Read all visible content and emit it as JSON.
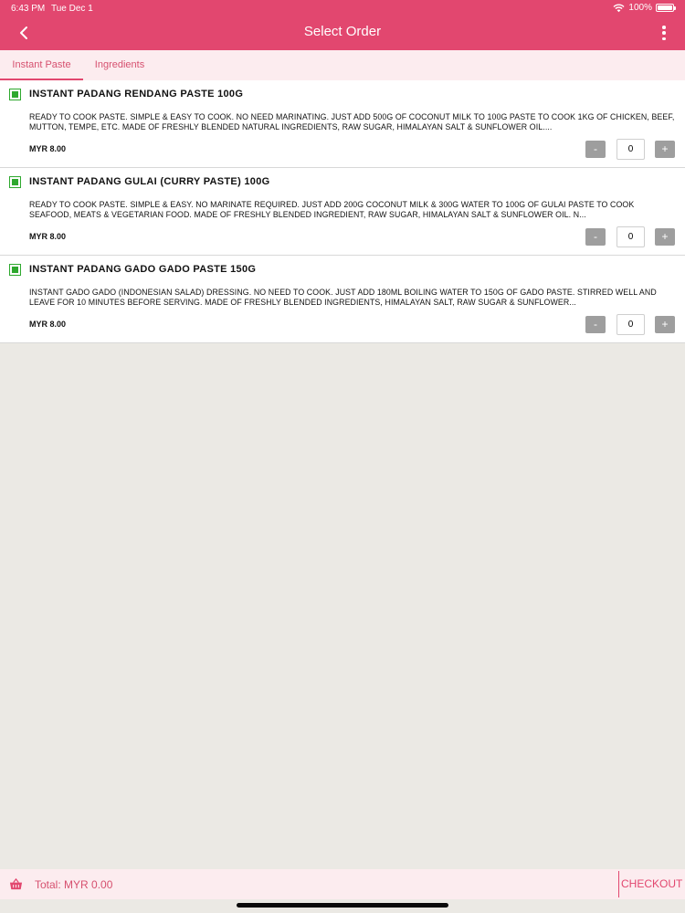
{
  "status": {
    "time": "6:43 PM",
    "date": "Tue Dec 1",
    "battery_text": "100%",
    "battery_level": 1.0
  },
  "header": {
    "title": "Select Order",
    "icons": {
      "back": "chevron-left-icon",
      "menu": "more-vertical-icon"
    }
  },
  "tabs": [
    {
      "label": "Instant Paste",
      "active": true
    },
    {
      "label": "Ingredients",
      "active": false
    }
  ],
  "items": [
    {
      "name": "INSTANT PADANG RENDANG PASTE 100G",
      "description": "READY TO COOK PASTE. SIMPLE & EASY TO COOK. NO NEED MARINATING. JUST ADD 500G OF COCONUT MILK TO 100G PASTE TO COOK 1KG OF CHICKEN, BEEF, MUTTON, TEMPE, ETC. MADE OF FRESHLY BLENDED NATURAL INGREDIENTS, RAW SUGAR, HIMALAYAN SALT & SUNFLOWER OIL....",
      "price": "MYR 8.00",
      "quantity": "0",
      "minus_label": "-",
      "plus_label": "+",
      "checked": true
    },
    {
      "name": "INSTANT PADANG GULAI (CURRY PASTE) 100G",
      "description": "READY TO COOK PASTE. SIMPLE & EASY. NO MARINATE REQUIRED. JUST ADD 200G COCONUT MILK & 300G WATER TO 100G OF GULAI PASTE TO COOK SEAFOOD, MEATS & VEGETARIAN FOOD. MADE OF FRESHLY BLENDED INGREDIENT, RAW SUGAR, HIMALAYAN SALT & SUNFLOWER OIL. N...",
      "price": "MYR 8.00",
      "quantity": "0",
      "minus_label": "-",
      "plus_label": "+",
      "checked": true
    },
    {
      "name": "INSTANT PADANG GADO GADO PASTE 150G",
      "description": "INSTANT GADO GADO (INDONESIAN SALAD) DRESSING. NO NEED TO COOK. JUST ADD 180ML BOILING WATER TO 150G OF GADO PASTE. STIRRED WELL AND LEAVE FOR 10 MINUTES BEFORE SERVING. MADE OF FRESHLY BLENDED INGREDIENTS, HIMALAYAN SALT, RAW SUGAR & SUNFLOWER...",
      "price": "MYR 8.00",
      "quantity": "0",
      "minus_label": "-",
      "plus_label": "+",
      "checked": true
    }
  ],
  "footer": {
    "total": "Total: MYR 0.00",
    "checkout_label": "CHECKOUT",
    "icon": "basket-icon"
  },
  "colors": {
    "accent": "#e2476f",
    "tab_bg": "#fcecef",
    "checkbox": "#2ea82e",
    "background": "#ebe9e4"
  }
}
